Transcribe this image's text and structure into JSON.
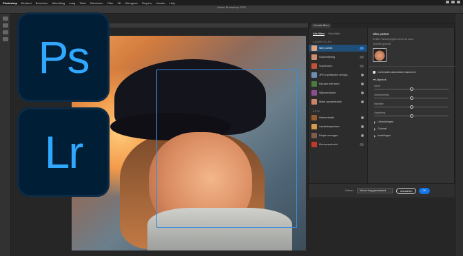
{
  "menubar": {
    "items": [
      "Photoshop",
      "Bestand",
      "Bewerken",
      "Afbeelding",
      "Laag",
      "Tekst",
      "Selecteren",
      "Filter",
      "3D",
      "Weergave",
      "Plug-ins",
      "Venster",
      "Help"
    ]
  },
  "window": {
    "title": "Adobe Photoshop 2022"
  },
  "logos": {
    "ps": "Ps",
    "lr": "Lr"
  },
  "panel": {
    "tab": "Neurale filters",
    "filters_tabs": {
      "all": "Alle filters",
      "wait": "Wachtlijst"
    },
    "sections": {
      "featured": "AANBEVOLEN",
      "beta": "BÈTA"
    },
    "featured": [
      {
        "label": "Slim portret",
        "thumb": "#e4a27a"
      },
      {
        "label": "Huidverfijning",
        "thumb": "#c88f73"
      },
      {
        "label": "Superzoom",
        "thumb": "#c1533a"
      },
      {
        "label": "JPEG-artefacten verwijd...",
        "thumb": "#6b8fb2"
      },
      {
        "label": "Kleuren met kleur",
        "thumb": "#4d7a3e"
      },
      {
        "label": "Stijloverdracht",
        "thumb": "#8b4f8f"
      },
      {
        "label": "Make-upoverdracht",
        "thumb": "#c9826b"
      }
    ],
    "beta": [
      {
        "label": "Harmonisatie",
        "thumb": "#9a5a30"
      },
      {
        "label": "Landschapsmixer",
        "thumb": "#d69a4b"
      },
      {
        "label": "Diepte vervagen",
        "thumb": "#7d5c4b"
      },
      {
        "label": "Kleuroverdracht",
        "thumb": "#c0392b"
      }
    ],
    "settings": {
      "title": "Slim portret",
      "subtitle": "Uit filter: Nemaal gegenereerd in de cloud",
      "selected_face": "Selecteer geschikt",
      "auto_balance": "Combinaties automatisch balanceren",
      "group_open": "Uitgelicht",
      "sliders": [
        {
          "label": "Geluk",
          "pos": 0.48
        },
        {
          "label": "Gezichtsleeftijd",
          "pos": 0.48
        },
        {
          "label": "Haardikte",
          "pos": 0.48
        },
        {
          "label": "Oogrichting",
          "pos": 0.48
        }
      ],
      "collapsed": [
        "Uitdrukkingen",
        "Globaal",
        "Instellingen"
      ]
    },
    "bottom": {
      "output_label": "Uitvoer",
      "output_value": "Nieuwe laag gemaskeerd",
      "cancel": "Annuleren",
      "ok": "OK"
    }
  }
}
